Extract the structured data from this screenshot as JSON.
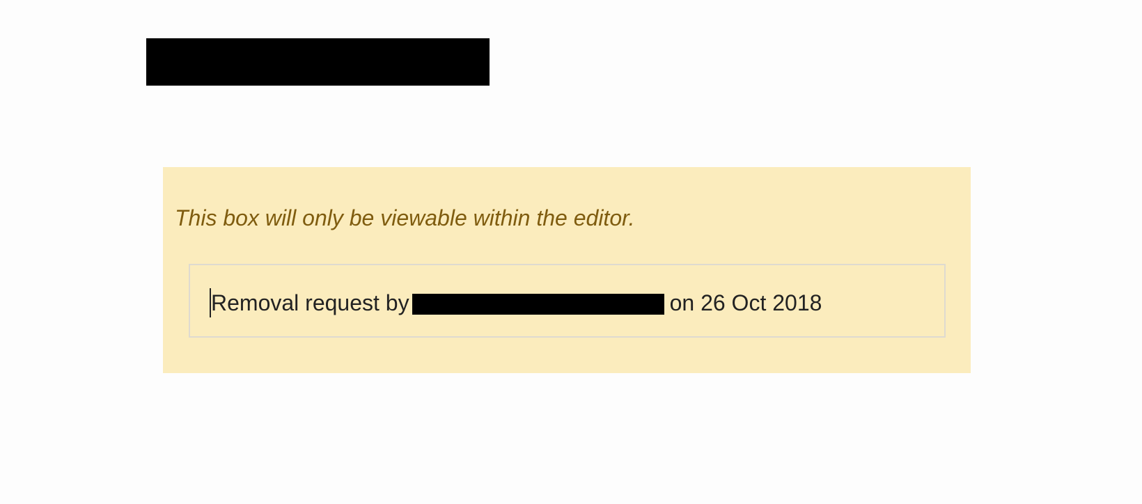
{
  "colors": {
    "page_background": "#fdfdfd",
    "note_box_background": "#fbecbd",
    "note_text": "#7f5c0f",
    "body_text": "#222222",
    "inner_box_border": "#dedad0",
    "redaction": "#000000"
  },
  "editor_note": {
    "message": "This box will only be viewable within the editor."
  },
  "removal_request": {
    "prefix": "Removal request by",
    "suffix": "on 26 Oct 2018"
  }
}
